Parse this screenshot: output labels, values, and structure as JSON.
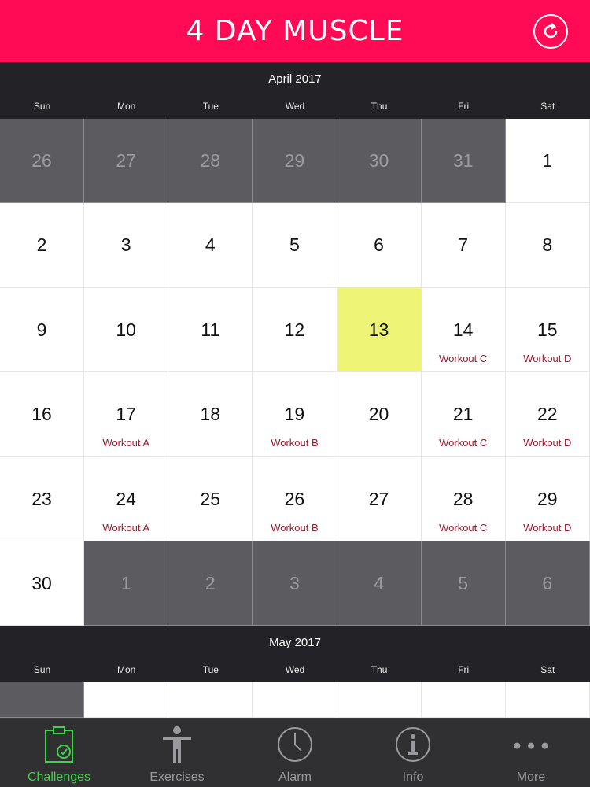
{
  "header": {
    "title": "4 DAY MUSCLE"
  },
  "weekdays": [
    "Sun",
    "Mon",
    "Tue",
    "Wed",
    "Thu",
    "Fri",
    "Sat"
  ],
  "april": {
    "title": "April 2017",
    "weeks": [
      [
        {
          "d": "26",
          "out": true
        },
        {
          "d": "27",
          "out": true
        },
        {
          "d": "28",
          "out": true
        },
        {
          "d": "29",
          "out": true
        },
        {
          "d": "30",
          "out": true
        },
        {
          "d": "31",
          "out": true
        },
        {
          "d": "1"
        }
      ],
      [
        {
          "d": "2"
        },
        {
          "d": "3"
        },
        {
          "d": "4"
        },
        {
          "d": "5"
        },
        {
          "d": "6"
        },
        {
          "d": "7"
        },
        {
          "d": "8"
        }
      ],
      [
        {
          "d": "9"
        },
        {
          "d": "10"
        },
        {
          "d": "11"
        },
        {
          "d": "12"
        },
        {
          "d": "13",
          "today": true
        },
        {
          "d": "14",
          "w": "Workout C"
        },
        {
          "d": "15",
          "w": "Workout D"
        }
      ],
      [
        {
          "d": "16"
        },
        {
          "d": "17",
          "w": "Workout A"
        },
        {
          "d": "18"
        },
        {
          "d": "19",
          "w": "Workout B"
        },
        {
          "d": "20"
        },
        {
          "d": "21",
          "w": "Workout C"
        },
        {
          "d": "22",
          "w": "Workout D"
        }
      ],
      [
        {
          "d": "23"
        },
        {
          "d": "24",
          "w": "Workout A"
        },
        {
          "d": "25"
        },
        {
          "d": "26",
          "w": "Workout B"
        },
        {
          "d": "27"
        },
        {
          "d": "28",
          "w": "Workout C"
        },
        {
          "d": "29",
          "w": "Workout D"
        }
      ],
      [
        {
          "d": "30"
        },
        {
          "d": "1",
          "out": true
        },
        {
          "d": "2",
          "out": true
        },
        {
          "d": "3",
          "out": true
        },
        {
          "d": "4",
          "out": true
        },
        {
          "d": "5",
          "out": true
        },
        {
          "d": "6",
          "out": true
        }
      ]
    ]
  },
  "may": {
    "title": "May 2017",
    "first_row": [
      {
        "out": true
      },
      {},
      {},
      {},
      {},
      {},
      {}
    ]
  },
  "tabbar": {
    "items": [
      {
        "label": "Challenges",
        "icon": "clipboard-check-icon",
        "active": true
      },
      {
        "label": "Exercises",
        "icon": "person-icon"
      },
      {
        "label": "Alarm",
        "icon": "clock-icon"
      },
      {
        "label": "Info",
        "icon": "info-icon"
      },
      {
        "label": "More",
        "icon": "more-dots-icon"
      }
    ]
  },
  "colors": {
    "accent": "#ff0a54",
    "today": "#eef576",
    "workout_text": "#9b1b2d",
    "active_tab": "#3ed34a"
  }
}
